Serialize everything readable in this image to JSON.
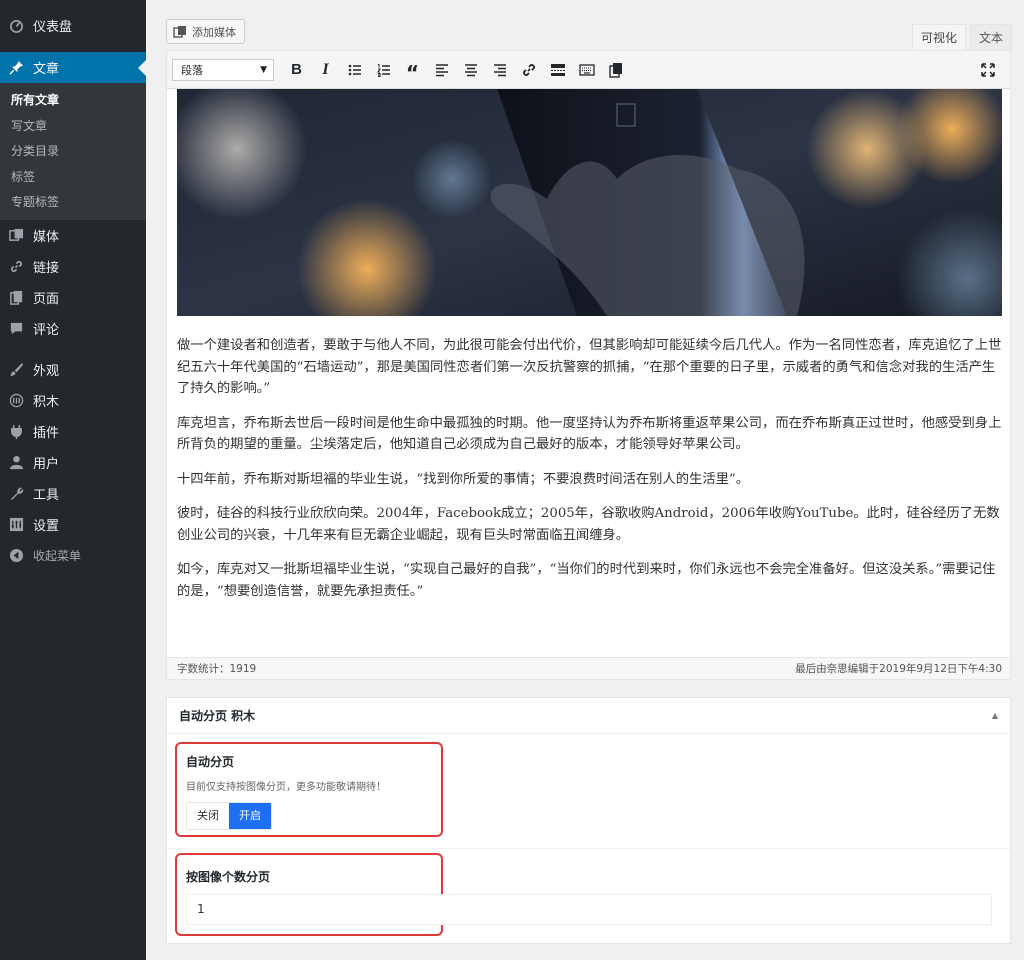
{
  "sidebar": {
    "items": [
      {
        "label": "仪表盘",
        "icon": "dashboard-icon"
      },
      {
        "label": "文章",
        "icon": "pin-icon",
        "active": true
      },
      {
        "label": "媒体",
        "icon": "media-icon"
      },
      {
        "label": "链接",
        "icon": "link-icon"
      },
      {
        "label": "页面",
        "icon": "page-icon"
      },
      {
        "label": "评论",
        "icon": "comment-icon"
      },
      {
        "label": "外观",
        "icon": "brush-icon"
      },
      {
        "label": "积木",
        "icon": "blocks-icon"
      },
      {
        "label": "插件",
        "icon": "plugin-icon"
      },
      {
        "label": "用户",
        "icon": "user-icon"
      },
      {
        "label": "工具",
        "icon": "wrench-icon"
      },
      {
        "label": "设置",
        "icon": "settings-icon"
      },
      {
        "label": "收起菜单",
        "icon": "collapse-icon"
      }
    ],
    "submenu": [
      "所有文章",
      "写文章",
      "分类目录",
      "标签",
      "专题标签"
    ]
  },
  "editor": {
    "add_media_label": "添加媒体",
    "tabs": {
      "visual": "可视化",
      "text": "文本"
    },
    "format_select": "段落",
    "paragraphs": [
      "做一个建设者和创造者，要敢于与他人不同，为此很可能会付出代价，但其影响却可能延续今后几代人。作为一名同性恋者，库克追忆了上世纪五六十年代美国的“石墙运动”，那是美国同性恋者们第一次反抗警察的抓捕，“在那个重要的日子里，示威者的勇气和信念对我的生活产生了持久的影响。”",
      "库克坦言，乔布斯去世后一段时间是他生命中最孤独的时期。他一度坚持认为乔布斯将重返苹果公司，而在乔布斯真正过世时，他感受到身上所背负的期望的重量。尘埃落定后，他知道自己必须成为自己最好的版本，才能领导好苹果公司。",
      "十四年前，乔布斯对斯坦福的毕业生说，“找到你所爱的事情；不要浪费时间活在别人的生活里”。",
      "彼时，硅谷的科技行业欣欣向荣。2004年，Facebook成立；2005年，谷歌收购Android，2006年收购YouTube。此时，硅谷经历了无数创业公司的兴衰，十几年来有巨无霸企业崛起，现有巨头时常面临丑闻缠身。",
      "如今，库克对又一批斯坦福毕业生说，“实现自己最好的自我”，“当你们的时代到来时，你们永远也不会完全准备好。但这没关系。”需要记住的是，“想要创造信誉，就要先承担责任。”"
    ],
    "word_count": "字数统计：1919",
    "last_edited": "最后由奈思编辑于2019年9月12日下午4:30"
  },
  "metabox": {
    "title": "自动分页 积木",
    "auto_paging": {
      "title": "自动分页",
      "desc": "目前仅支持按图像分页，更多功能敬请期待！",
      "off_label": "关闭",
      "on_label": "开启",
      "selected": "开启"
    },
    "image_count": {
      "title": "按图像个数分页",
      "value": "1"
    }
  },
  "colors": {
    "sidebar_bg": "#23282d",
    "active_menu": "#0073aa",
    "toggle_on": "#1e6ff5",
    "highlight_border": "#e03a3a"
  }
}
